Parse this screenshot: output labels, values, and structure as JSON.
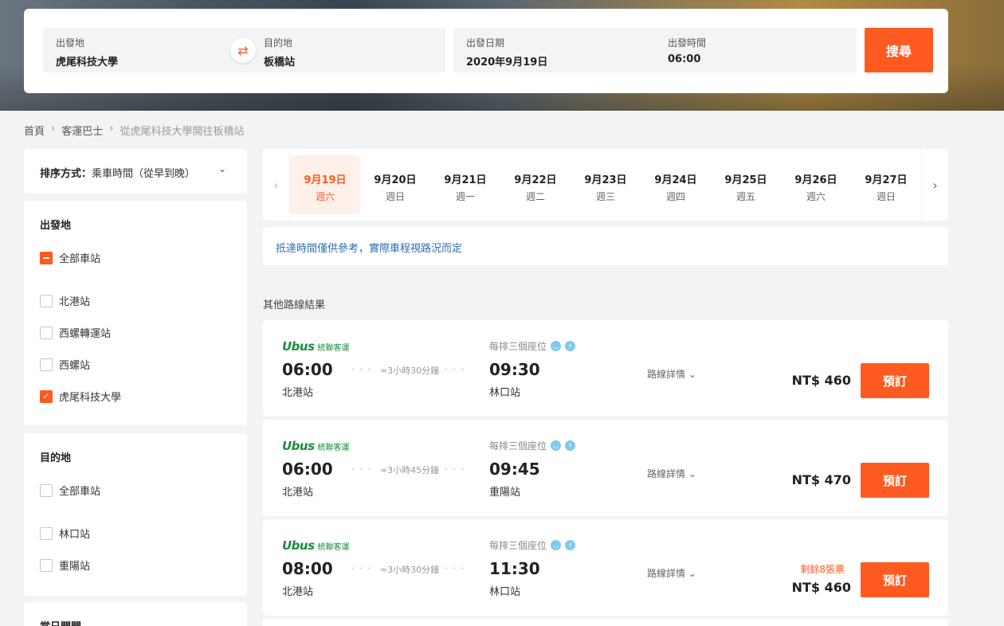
{
  "search": {
    "origin_label": "出發地",
    "origin_value": "虎尾科技大學",
    "dest_label": "目的地",
    "dest_value": "板橋站",
    "date_label": "出發日期",
    "date_value": "2020年9月19日",
    "time_label": "出發時間",
    "time_value": "06:00",
    "search_button": "搜尋",
    "swap_icon": "⇄"
  },
  "breadcrumb": {
    "home": "首頁",
    "category": "客運巴士",
    "current": "從虎尾科技大學開往板橋站",
    "sep": "›"
  },
  "sort": {
    "prefix": "排序方式：",
    "value": "乘車時間（從早到晚）",
    "chevron": "⌄"
  },
  "filters": {
    "origin": {
      "title": "出發地",
      "all": "全部車站",
      "stations": [
        "北港站",
        "西螺轉運站",
        "西螺站",
        "虎尾科技大學"
      ]
    },
    "dest": {
      "title": "目的地",
      "all": "全部車站",
      "stations": [
        "林口站",
        "重陽站"
      ]
    },
    "more_title": "當日開開"
  },
  "dates": [
    {
      "date": "9月19日",
      "weekday": "週六"
    },
    {
      "date": "9月20日",
      "weekday": "週日"
    },
    {
      "date": "9月21日",
      "weekday": "週一"
    },
    {
      "date": "9月22日",
      "weekday": "週二"
    },
    {
      "date": "9月23日",
      "weekday": "週三"
    },
    {
      "date": "9月24日",
      "weekday": "週四"
    },
    {
      "date": "9月25日",
      "weekday": "週五"
    },
    {
      "date": "9月26日",
      "weekday": "週六"
    },
    {
      "date": "9月27日",
      "weekday": "週日"
    }
  ],
  "date_nav": {
    "prev": "‹",
    "next": "›"
  },
  "notice": "抵達時間僅供參考，實際車程視路況而定",
  "section_title": "其他路線結果",
  "routes": [
    {
      "logo_mark": "Ubus",
      "logo_name": "統聯客運",
      "seat": "每排三個座位",
      "dep_time": "06:00",
      "dep_station": "北港站",
      "duration": "≈3小時30分鐘",
      "arr_time": "09:30",
      "arr_station": "林口站",
      "detail": "路線詳情 ⌄",
      "price": "NT$ 460",
      "remain": "",
      "book": "預訂"
    },
    {
      "logo_mark": "Ubus",
      "logo_name": "統聯客運",
      "seat": "每排三個座位",
      "dep_time": "06:00",
      "dep_station": "北港站",
      "duration": "≈3小時45分鐘",
      "arr_time": "09:45",
      "arr_station": "重陽站",
      "detail": "路線詳情 ⌄",
      "price": "NT$ 470",
      "remain": "",
      "book": "預訂"
    },
    {
      "logo_mark": "Ubus",
      "logo_name": "統聯客運",
      "seat": "每排三個座位",
      "dep_time": "08:00",
      "dep_station": "北港站",
      "duration": "≈3小時30分鐘",
      "arr_time": "11:30",
      "arr_station": "林口站",
      "detail": "路線詳情 ⌄",
      "price": "NT$ 460",
      "remain": "剩餘8張票",
      "book": "預訂"
    }
  ],
  "colors": {
    "accent": "#ff5a1f",
    "brand_green": "#1a8c3c",
    "link_blue": "#2e6eb5"
  }
}
